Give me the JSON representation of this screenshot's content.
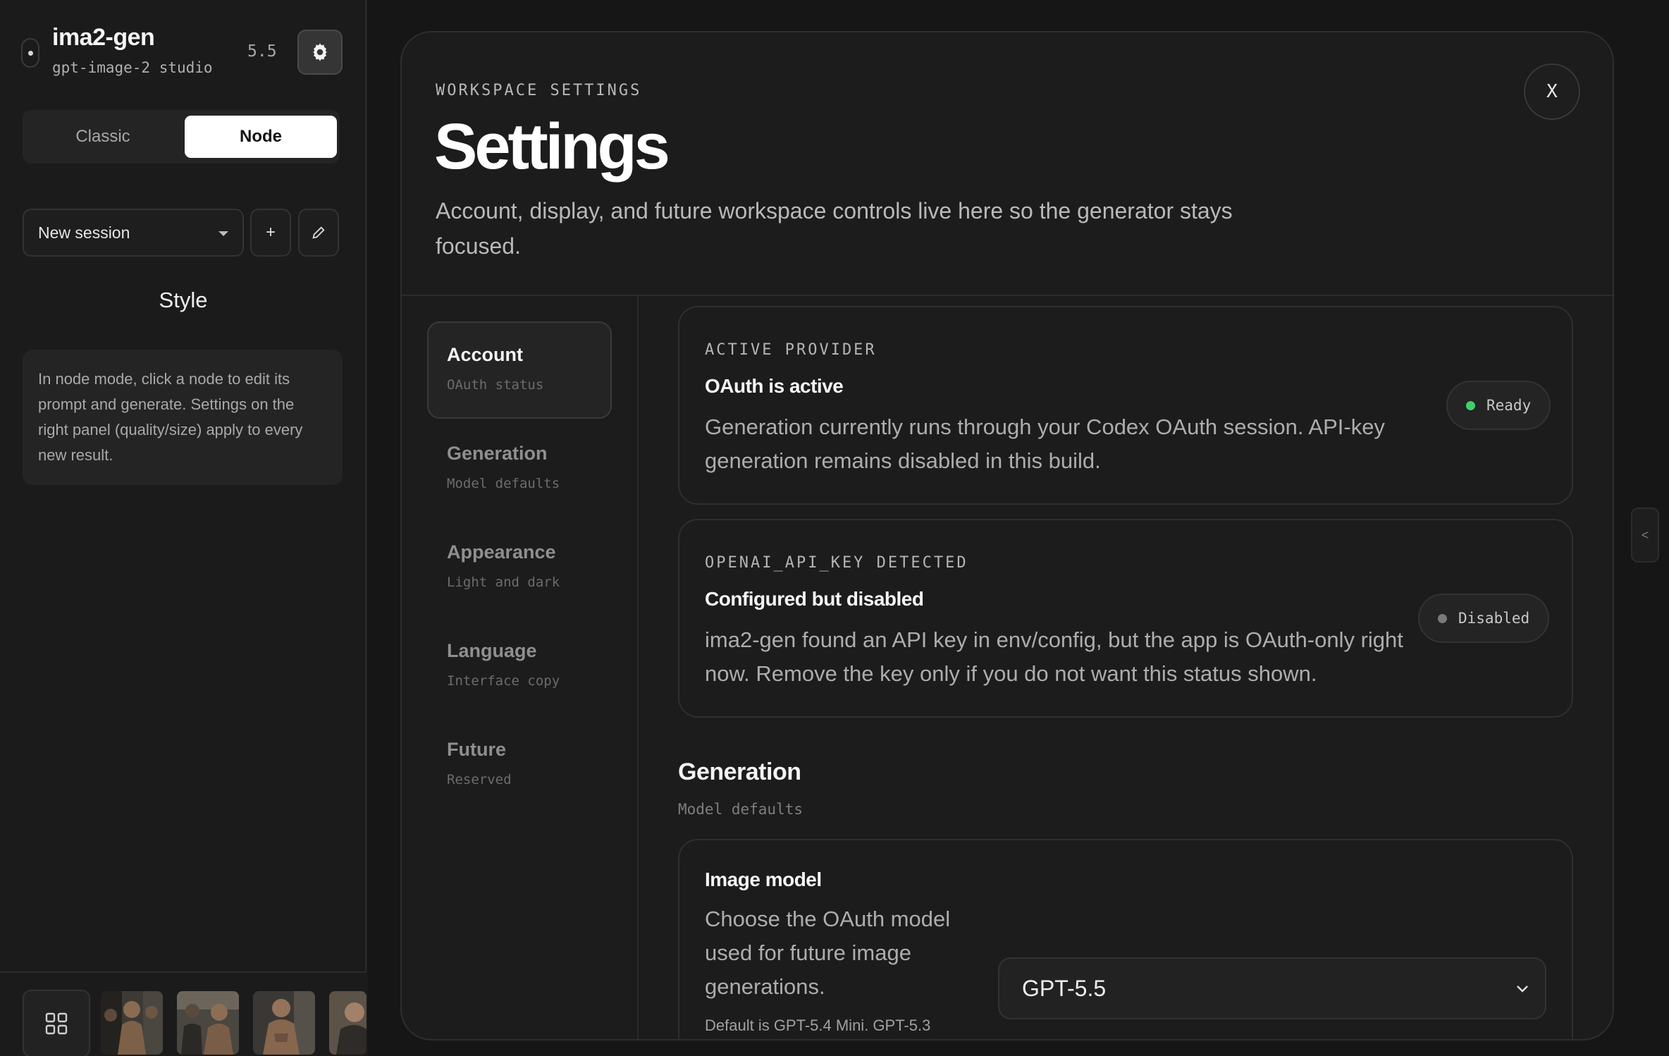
{
  "sidebar": {
    "brand": {
      "title": "ima2-gen",
      "subtitle": "gpt-image-2 studio",
      "version": "5.5",
      "settings_icon": "gear-icon"
    },
    "mode_toggle": {
      "options": [
        "Classic",
        "Node"
      ],
      "selected": "Node"
    },
    "session": {
      "selected": "New session",
      "add_label": "+",
      "edit_label": "✎"
    },
    "style_title": "Style",
    "note": "In node mode, click a node to edit its prompt and generate. Settings on the right panel (quality/size) apply to every new result.",
    "gallery": {
      "grid_icon": "grid-icon",
      "thumbnail_count": 4
    }
  },
  "side_handle_label": "<",
  "modal": {
    "eyebrow": "WORKSPACE SETTINGS",
    "title": "Settings",
    "description": "Account, display, and future workspace controls live here so the generator stays focused.",
    "close_label": "X",
    "nav": [
      {
        "label": "Account",
        "sub": "OAuth status",
        "active": true
      },
      {
        "label": "Generation",
        "sub": "Model defaults",
        "active": false
      },
      {
        "label": "Appearance",
        "sub": "Light and dark",
        "active": false
      },
      {
        "label": "Language",
        "sub": "Interface copy",
        "active": false
      },
      {
        "label": "Future",
        "sub": "Reserved",
        "active": false
      }
    ],
    "cards": {
      "provider": {
        "eyebrow": "ACTIVE PROVIDER",
        "title": "OAuth is active",
        "body": "Generation currently runs through your Codex OAuth session. API-key generation remains disabled in this build.",
        "status": "Ready",
        "status_color": "#3fcf6a"
      },
      "api_key": {
        "eyebrow": "OPENAI_API_KEY DETECTED",
        "title": "Configured but disabled",
        "body": "ima2-gen found an API key in env/config, but the app is OAuth-only right now. Remove the key only if you do not want this status shown.",
        "status": "Disabled",
        "status_color": "#7a7a7a"
      }
    },
    "generation_section": {
      "title": "Generation",
      "subtitle": "Model defaults",
      "image_model": {
        "title": "Image model",
        "description": "Choose the OAuth model used for future image generations.",
        "hint": "Default is GPT-5.4 Mini. GPT-5.3",
        "selected": "GPT-5.5"
      }
    }
  }
}
